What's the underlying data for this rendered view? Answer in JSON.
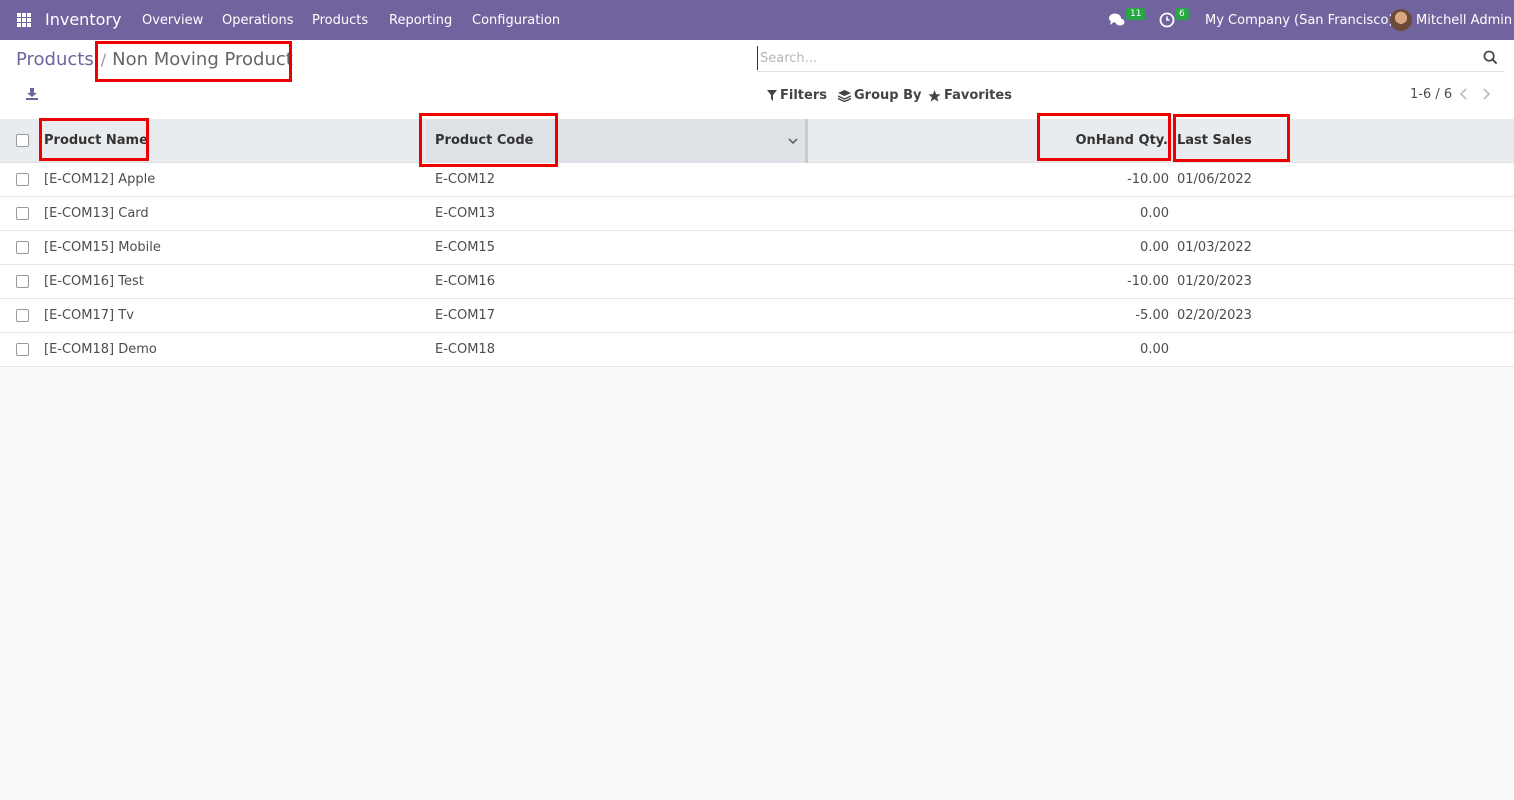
{
  "navbar": {
    "app_name": "Inventory",
    "menu": [
      "Overview",
      "Operations",
      "Products",
      "Reporting",
      "Configuration"
    ],
    "messages_badge": "11",
    "activities_badge": "6",
    "company": "My Company (San Francisco)",
    "user": "Mitchell Admin",
    "bg_color": "#71639e"
  },
  "breadcrumb": {
    "parent": "Products",
    "separator": "/",
    "current": "Non Moving Product"
  },
  "search": {
    "placeholder": "Search..."
  },
  "toolbar": {
    "filters": "Filters",
    "group_by": "Group By",
    "favorites": "Favorites",
    "pager": "1-6 / 6"
  },
  "table": {
    "columns": [
      "Product Name",
      "Product Code",
      "OnHand Qty.",
      "Last Sales"
    ],
    "rows": [
      {
        "name": "[E-COM12] Apple",
        "code": "E-COM12",
        "qty": "-10.00",
        "last_sales": "01/06/2022"
      },
      {
        "name": "[E-COM13] Card",
        "code": "E-COM13",
        "qty": "0.00",
        "last_sales": ""
      },
      {
        "name": "[E-COM15] Mobile",
        "code": "E-COM15",
        "qty": "0.00",
        "last_sales": "01/03/2022"
      },
      {
        "name": "[E-COM16] Test",
        "code": "E-COM16",
        "qty": "-10.00",
        "last_sales": "01/20/2023"
      },
      {
        "name": "[E-COM17] Tv",
        "code": "E-COM17",
        "qty": "-5.00",
        "last_sales": "02/20/2023"
      },
      {
        "name": "[E-COM18] Demo",
        "code": "E-COM18",
        "qty": "0.00",
        "last_sales": ""
      }
    ]
  }
}
